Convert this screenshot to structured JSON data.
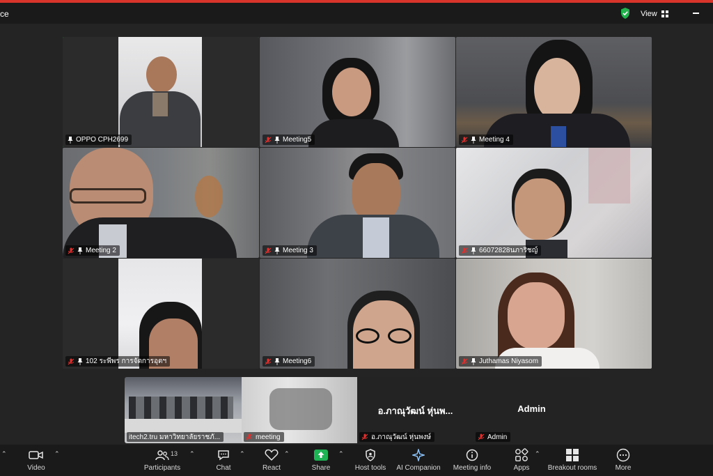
{
  "window": {
    "title_fragment": "ce"
  },
  "topbar": {
    "view_label": "View",
    "secure_icon": "shield-check-icon",
    "view_icon": "grid-icon",
    "minimize_icon": "minimize-icon"
  },
  "colors": {
    "active_speaker": "#3ccf6e",
    "accent_red": "#d9342b",
    "share_green": "#1fb355",
    "muted_red": "#e0302e"
  },
  "gallery": [
    {
      "name": "OPPO CPH2699",
      "muted": false,
      "active": true
    },
    {
      "name": "Meeting5",
      "muted": true,
      "active": false
    },
    {
      "name": "Meeting 4",
      "muted": true,
      "active": false
    },
    {
      "name": "Meeting 2",
      "muted": true,
      "active": false
    },
    {
      "name": "Meeting 3",
      "muted": true,
      "active": false
    },
    {
      "name": "66072828นภาริชญ์",
      "muted": true,
      "active": false
    },
    {
      "name": "102 ระพีพร การจัดการอุตฯ",
      "muted": true,
      "active": false
    },
    {
      "name": "Meeting6",
      "muted": true,
      "active": false
    },
    {
      "name": "Juthamas Niyasom",
      "muted": true,
      "active": false
    }
  ],
  "filmstrip": [
    {
      "name": "itech2.tru มหาวิทยาลัยราชภั...",
      "muted": false,
      "center_name": ""
    },
    {
      "name": "meeting",
      "muted": true,
      "center_name": ""
    },
    {
      "name": "อ.ภาณุวัฒน์ หุ่นพงษ์",
      "muted": true,
      "center_name": "อ.ภาณุวัฒน์ หุ่นพ..."
    },
    {
      "name": "Admin",
      "muted": true,
      "center_name": "Admin"
    }
  ],
  "toolbar": {
    "video": "Video",
    "participants": "Participants",
    "participants_count": "13",
    "chat": "Chat",
    "react": "React",
    "share": "Share",
    "host_tools": "Host tools",
    "ai_companion": "AI Companion",
    "meeting_info": "Meeting info",
    "apps": "Apps",
    "breakout_rooms": "Breakout rooms",
    "more": "More"
  }
}
